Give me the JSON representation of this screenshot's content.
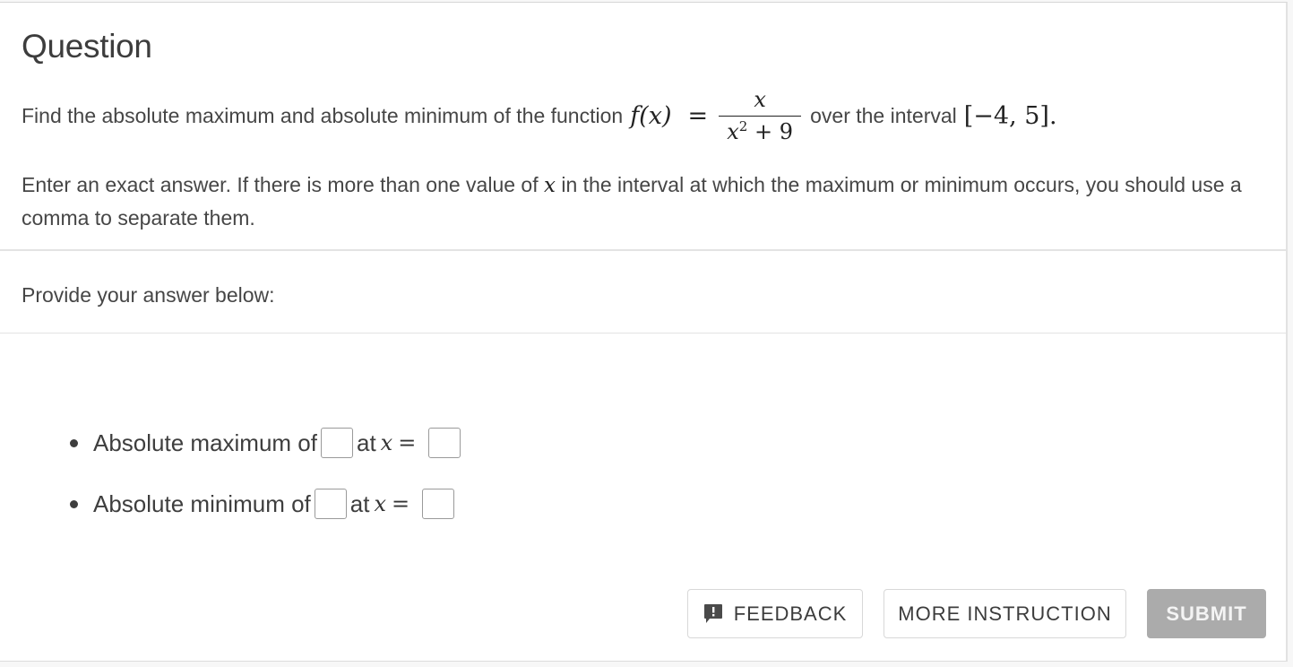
{
  "question": {
    "title": "Question",
    "prompt_before": "Find the absolute maximum and absolute minimum of the function",
    "function_name": "f(x)",
    "equals": "=",
    "numerator": "x",
    "denominator_base": "x",
    "denominator_exp": "2",
    "denominator_rest": "+ 9",
    "prompt_after": "over the interval",
    "interval": "[−4, 5].",
    "instruction_part1": "Enter an exact answer. If there is more than one value of",
    "instruction_var": "x",
    "instruction_part2": "in the interval at which the maximum or minimum occurs, you should use a comma to separate them."
  },
  "answer_section": {
    "label": "Provide your answer below:",
    "items": [
      {
        "label": "Absolute maximum of",
        "at_label": "at",
        "var": "x",
        "eq": "=",
        "value": "",
        "x_value": ""
      },
      {
        "label": "Absolute minimum of",
        "at_label": "at",
        "var": "x",
        "eq": "=",
        "value": "",
        "x_value": ""
      }
    ]
  },
  "buttons": {
    "feedback": "FEEDBACK",
    "feedback_icon": "feedback-icon",
    "more_instruction": "MORE INSTRUCTION",
    "submit": "SUBMIT"
  },
  "colors": {
    "submit_disabled": "#ababab",
    "text": "#464646"
  }
}
